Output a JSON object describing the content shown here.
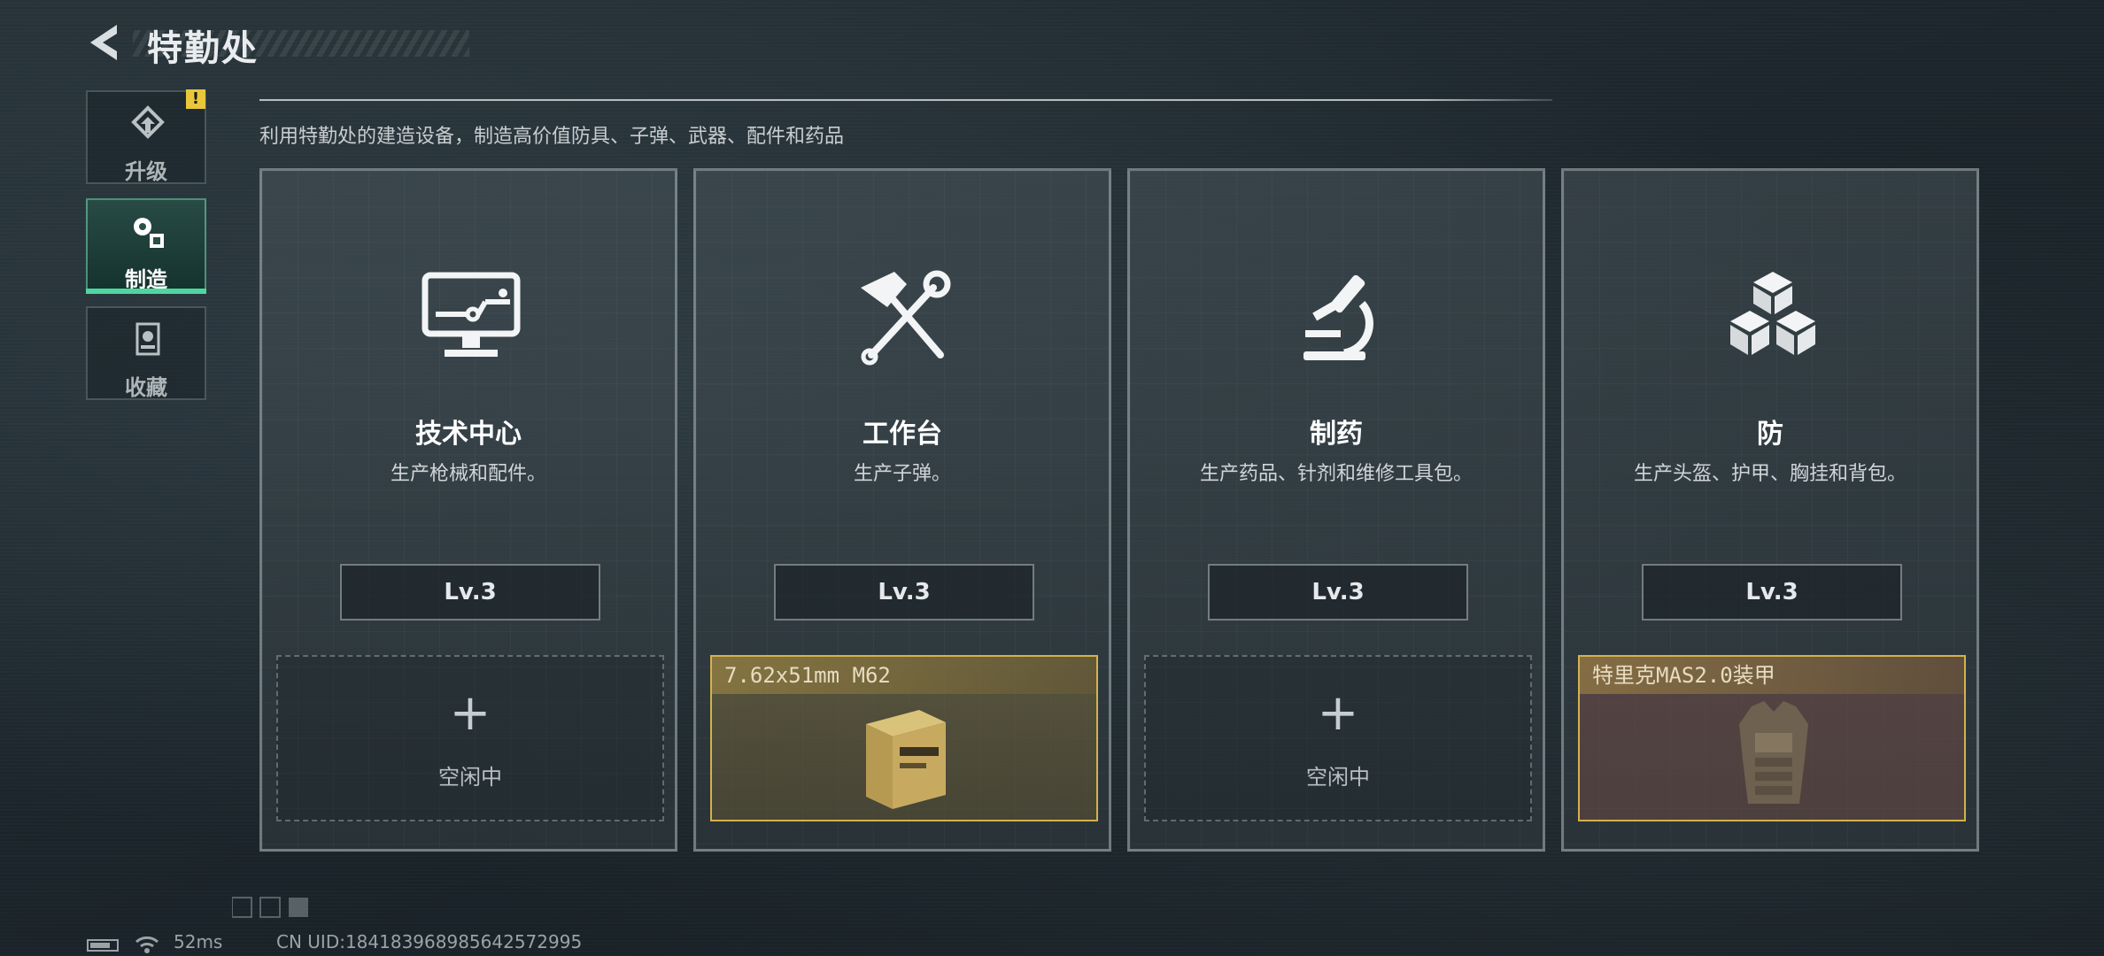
{
  "header": {
    "title": "特勤处"
  },
  "sidebar": {
    "items": [
      {
        "label": "升级",
        "icon": "upgrade-icon",
        "badge": "!"
      },
      {
        "label": "制造",
        "icon": "craft-gear-icon",
        "active": true
      },
      {
        "label": "收藏",
        "icon": "collection-icon"
      }
    ]
  },
  "main": {
    "subtitle": "利用特勤处的建造设备，制造高价值防具、子弹、武器、配件和药品",
    "cards": [
      {
        "name": "技术中心",
        "desc": "生产枪械和配件。",
        "level": "Lv.3",
        "icon": "computer-monitor-icon",
        "slot": {
          "state": "idle",
          "label": "空闲中"
        }
      },
      {
        "name": "工作台",
        "desc": "生产子弹。",
        "level": "Lv.3",
        "icon": "hammer-wrench-icon",
        "slot": {
          "state": "busy",
          "item": "7.62x51mm M62"
        }
      },
      {
        "name": "制药",
        "desc": "生产药品、针剂和维修工具包。",
        "level": "Lv.3",
        "icon": "microscope-icon",
        "slot": {
          "state": "idle",
          "label": "空闲中"
        }
      },
      {
        "name": "防",
        "desc": "生产头盔、护甲、胸挂和背包。",
        "level": "Lv.3",
        "icon": "cubes-icon",
        "slot": {
          "state": "busy",
          "item": "特里克MAS2.0装甲"
        }
      }
    ]
  },
  "footer": {
    "ping": "52ms",
    "uid": "CN UID:18418396898564257​2995"
  },
  "colors": {
    "accent_green": "#4fd6a0",
    "busy_gold": "#d4b24c",
    "badge_yellow": "#e8c83a"
  }
}
